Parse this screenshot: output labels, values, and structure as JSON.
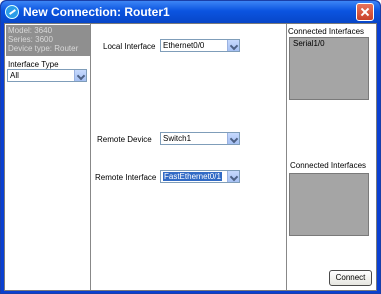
{
  "window": {
    "title": "New Connection: Router1"
  },
  "device_info": {
    "model": "Model: 3640",
    "series": "Series: 3600",
    "device_type": "Device type: Router"
  },
  "interface_type": {
    "label": "Interface Type",
    "value": "All"
  },
  "local_interface": {
    "label": "Local Interface",
    "value": "Ethernet0/0"
  },
  "remote_device": {
    "label": "Remote Device",
    "value": "Switch1"
  },
  "remote_interface": {
    "label": "Remote Interface",
    "value": "FastEthernet0/1"
  },
  "connected_local": {
    "label": "Connected Interfaces",
    "items": [
      "Serial1/0"
    ]
  },
  "connected_remote": {
    "label": "Connected Interfaces",
    "items": []
  },
  "actions": {
    "connect_label": "Connect"
  },
  "colors": {
    "titlebar": "#0b54e0",
    "panel_gray": "#a8a8a8",
    "selection": "#316ac5"
  }
}
